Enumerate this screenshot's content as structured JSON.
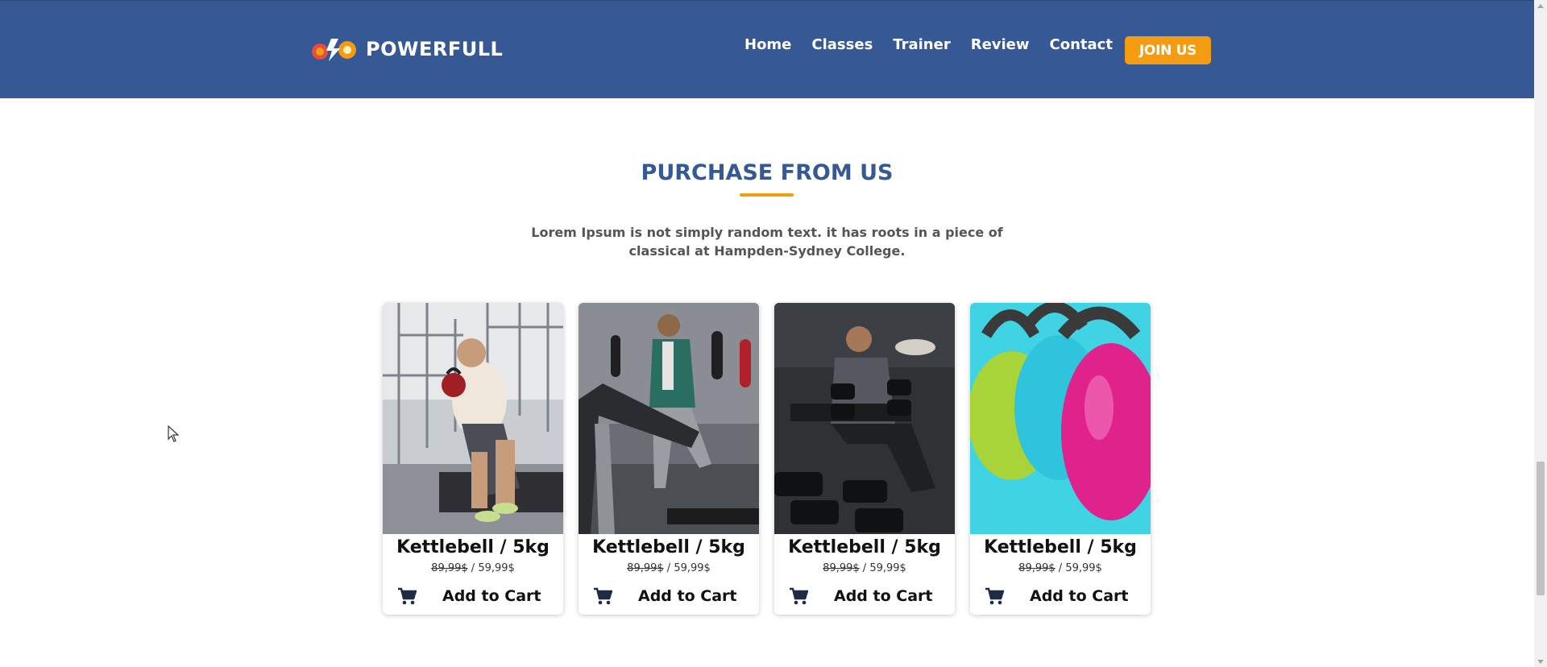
{
  "header": {
    "logo_text": "POWERFULL",
    "nav": [
      "Home",
      "Classes",
      "Trainer",
      "Review",
      "Contact"
    ],
    "cta_label": "JOIN US"
  },
  "colors": {
    "header_bg": "#365894",
    "accent": "#f39c12",
    "title": "#365894"
  },
  "section": {
    "title": "PURCHASE FROM US",
    "description": "Lorem Ipsum is not simply random text. it has roots in a piece of classical at Hampden-Sydney College."
  },
  "products": [
    {
      "title": "Kettlebell / 5kg",
      "old_price": "89,99$",
      "separator": " / ",
      "price": "59,99$",
      "cart_label": "Add to Cart",
      "image": "man-kettlebell-photo"
    },
    {
      "title": "Kettlebell / 5kg",
      "old_price": "89,99$",
      "separator": " / ",
      "price": "59,99$",
      "cart_label": "Add to Cart",
      "image": "man-treadmill-photo"
    },
    {
      "title": "Kettlebell / 5kg",
      "old_price": "89,99$",
      "separator": " / ",
      "price": "59,99$",
      "cart_label": "Add to Cart",
      "image": "man-dumbbells-photo"
    },
    {
      "title": "Kettlebell / 5kg",
      "old_price": "89,99$",
      "separator": " / ",
      "price": "59,99$",
      "cart_label": "Add to Cart",
      "image": "colorful-kettlebells-photo"
    }
  ],
  "icons": {
    "cart": "shopping-cart-icon",
    "cursor": "mouse-pointer-icon"
  }
}
